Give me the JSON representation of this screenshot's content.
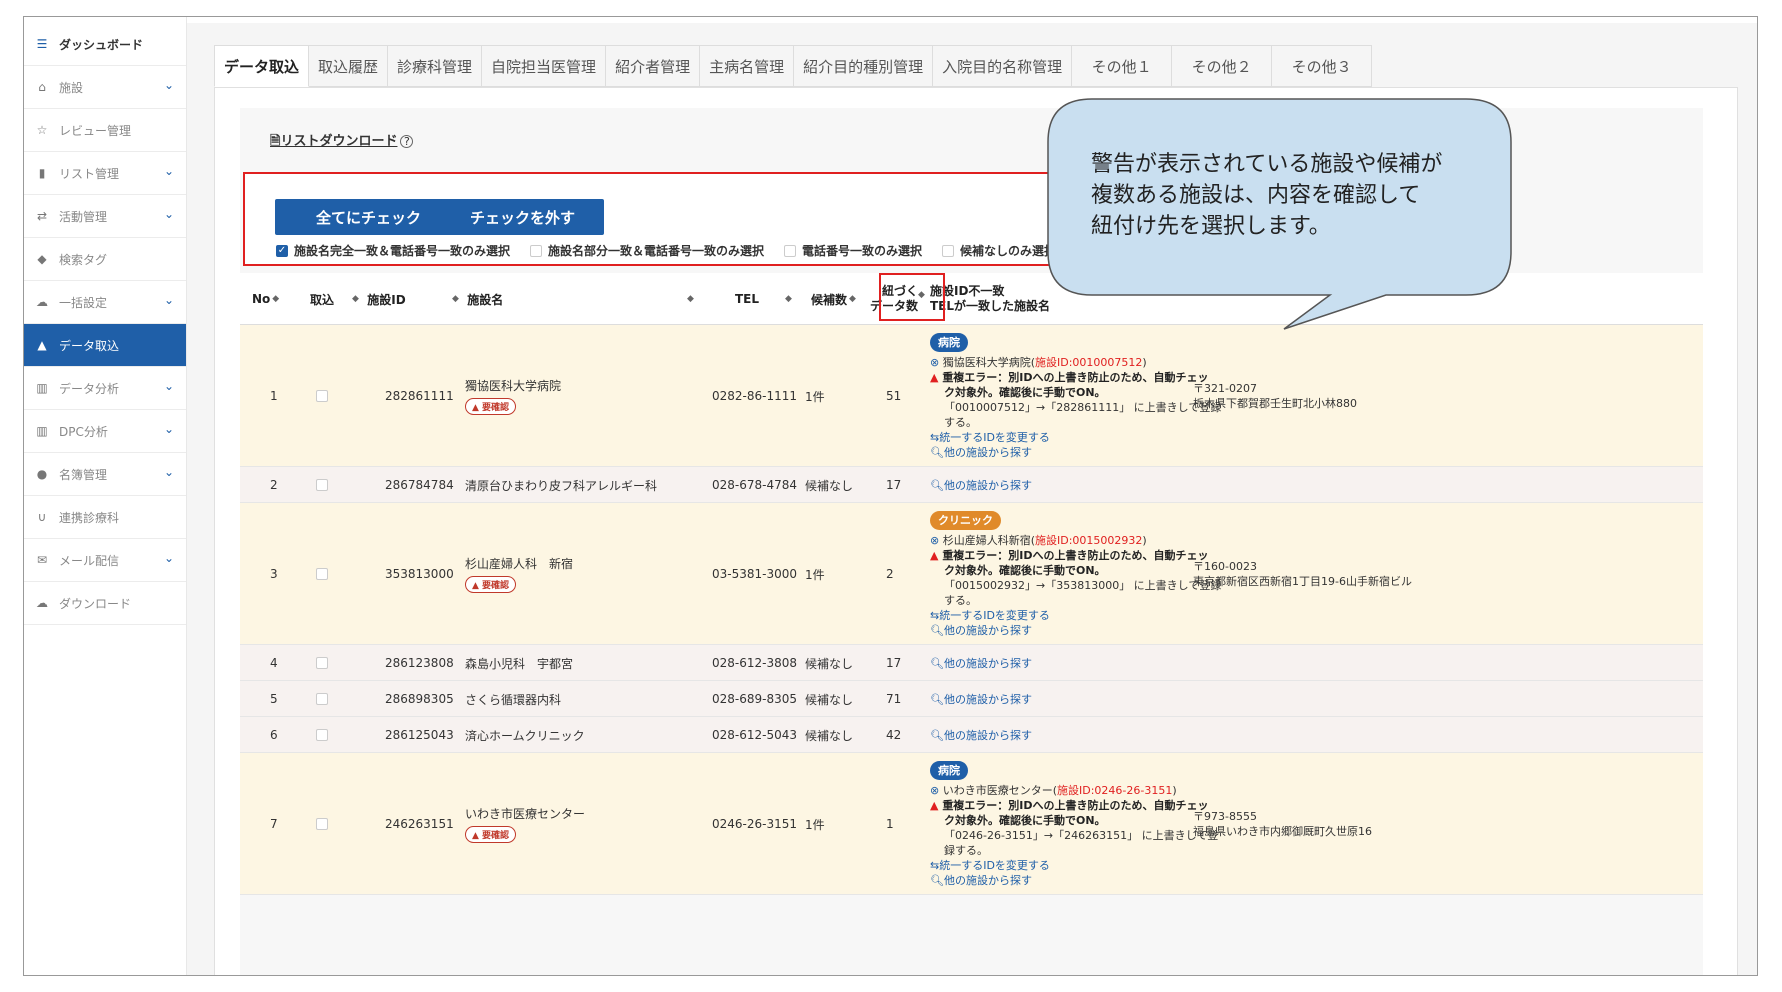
{
  "sidebar": {
    "items": [
      {
        "label": "ダッシュボード",
        "icon": "list-icon",
        "chevron": false,
        "state": "top"
      },
      {
        "label": "施設",
        "icon": "home-icon",
        "chevron": true,
        "state": ""
      },
      {
        "label": "レビュー管理",
        "icon": "star-box-icon",
        "chevron": false,
        "state": ""
      },
      {
        "label": "リスト管理",
        "icon": "bookmark-icon",
        "chevron": true,
        "state": ""
      },
      {
        "label": "活動管理",
        "icon": "handshake-icon",
        "chevron": true,
        "state": ""
      },
      {
        "label": "検索タグ",
        "icon": "tag-icon",
        "chevron": false,
        "state": ""
      },
      {
        "label": "一括設定",
        "icon": "cloud-upload-icon",
        "chevron": true,
        "state": ""
      },
      {
        "label": "データ取込",
        "icon": "file-upload-icon",
        "chevron": false,
        "state": "active"
      },
      {
        "label": "データ分析",
        "icon": "bar-chart-icon",
        "chevron": true,
        "state": ""
      },
      {
        "label": "DPC分析",
        "icon": "bar-chart-icon",
        "chevron": true,
        "state": ""
      },
      {
        "label": "名簿管理",
        "icon": "person-icon",
        "chevron": true,
        "state": ""
      },
      {
        "label": "連携診療科",
        "icon": "stethoscope-icon",
        "chevron": false,
        "state": ""
      },
      {
        "label": "メール配信",
        "icon": "mail-icon",
        "chevron": true,
        "state": ""
      },
      {
        "label": "ダウンロード",
        "icon": "cloud-download-icon",
        "chevron": false,
        "state": ""
      }
    ]
  },
  "tabs": [
    "データ取込",
    "取込履歴",
    "診療科管理",
    "自院担当医管理",
    "紹介者管理",
    "主病名管理",
    "紹介目的種別管理",
    "入院目的名称管理",
    "その他１",
    "その他２",
    "その他３"
  ],
  "download_link": "リストダウンロード",
  "help_icon": "?",
  "buttons": {
    "check_all": "全てにチェック",
    "uncheck": "チェックを外す"
  },
  "options": [
    {
      "label": "施設名完全一致＆電話番号一致のみ選択",
      "checked": true
    },
    {
      "label": "施設名部分一致＆電話番号一致のみ選択",
      "checked": false
    },
    {
      "label": "電話番号一致のみ選択",
      "checked": false
    },
    {
      "label": "候補なしのみ選択",
      "checked": false
    }
  ],
  "table": {
    "headers": {
      "no": "No",
      "import": "取込",
      "id": "施設ID",
      "name": "施設名",
      "tel": "TEL",
      "candidates": "候補数",
      "linked_1": "紐づく",
      "linked_2": "データ数",
      "mismatch_1": "施設ID不一致",
      "mismatch_2": "TELが一致した施設名"
    },
    "rows": [
      {
        "no": "1",
        "id": "282861111",
        "name": "獨協医科大学病院",
        "badge": "▲ 要確認",
        "tel": "0282-86-1111",
        "candidates": "1件",
        "count": "51",
        "tag": "病院",
        "tag_color": "blue",
        "match_name": "獨協医科大学病院(",
        "match_id": "施設ID:0010007512",
        "match_close": ")",
        "error_1": "重複エラー：別IDへの上書き防止のため、自動チェッ",
        "error_2": "ク対象外。確認後に手動でON。",
        "error_3": "「0010007512」→「282861111」 に上書きして登録",
        "error_4": "する。",
        "change_link": "統一するIDを変更する",
        "search_link": "他の施設から探す",
        "zip": "〒321-0207",
        "addr": "栃木県下都賀郡壬生町北小林880"
      },
      {
        "no": "2",
        "id": "286784784",
        "name": "清原台ひまわり皮フ科アレルギー科",
        "tel": "028-678-4784",
        "candidates": "候補なし",
        "count": "17",
        "search_link": "他の施設から探す"
      },
      {
        "no": "3",
        "id": "353813000",
        "name": "杉山産婦人科　新宿",
        "badge": "▲ 要確認",
        "tel": "03-5381-3000",
        "candidates": "1件",
        "count": "2",
        "tag": "クリニック",
        "tag_color": "orange",
        "match_name": "杉山産婦人科新宿(",
        "match_id": "施設ID:0015002932",
        "match_close": ")",
        "error_1": "重複エラー：別IDへの上書き防止のため、自動チェッ",
        "error_2": "ク対象外。確認後に手動でON。",
        "error_3": "「0015002932」→「353813000」 に上書きして登録",
        "error_4": "する。",
        "change_link": "統一するIDを変更する",
        "search_link": "他の施設から探す",
        "zip": "〒160-0023",
        "addr": "東京都新宿区西新宿1丁目19-6山手新宿ビル"
      },
      {
        "no": "4",
        "id": "286123808",
        "name": "森島小児科　宇都宮",
        "tel": "028-612-3808",
        "candidates": "候補なし",
        "count": "17",
        "search_link": "他の施設から探す"
      },
      {
        "no": "5",
        "id": "286898305",
        "name": "さくら循環器内科",
        "tel": "028-689-8305",
        "candidates": "候補なし",
        "count": "71",
        "search_link": "他の施設から探す"
      },
      {
        "no": "6",
        "id": "286125043",
        "name": "済心ホームクリニック",
        "tel": "028-612-5043",
        "candidates": "候補なし",
        "count": "42",
        "search_link": "他の施設から探す"
      },
      {
        "no": "7",
        "id": "246263151",
        "name": "いわき市医療センター",
        "badge": "▲ 要確認",
        "tel": "0246-26-3151",
        "candidates": "1件",
        "count": "1",
        "tag": "病院",
        "tag_color": "blue",
        "match_name": "いわき市医療センター(",
        "match_id": "施設ID:0246-26-3151",
        "match_close": ")",
        "error_1": "重複エラー：別IDへの上書き防止のため、自動チェッ",
        "error_2": "ク対象外。確認後に手動でON。",
        "error_3": "「0246-26-3151」→「246263151」 に上書きして登",
        "error_4": "録する。",
        "change_link": "統一するIDを変更する",
        "search_link": "他の施設から探す",
        "zip": "〒973-8555",
        "addr": "福島県いわき市内郷御厩町久世原16"
      }
    ]
  },
  "callout": {
    "text": "警告が表示されている施設や候補が\n複数ある施設は、内容を確認して\n紐付け先を選択します。"
  },
  "colors": {
    "primary": "#1f5fa8",
    "highlight": "#e02020",
    "callout_fill": "#c9dff0",
    "warn_row": "#fdf6e3",
    "badge_orange": "#e08a2a"
  }
}
